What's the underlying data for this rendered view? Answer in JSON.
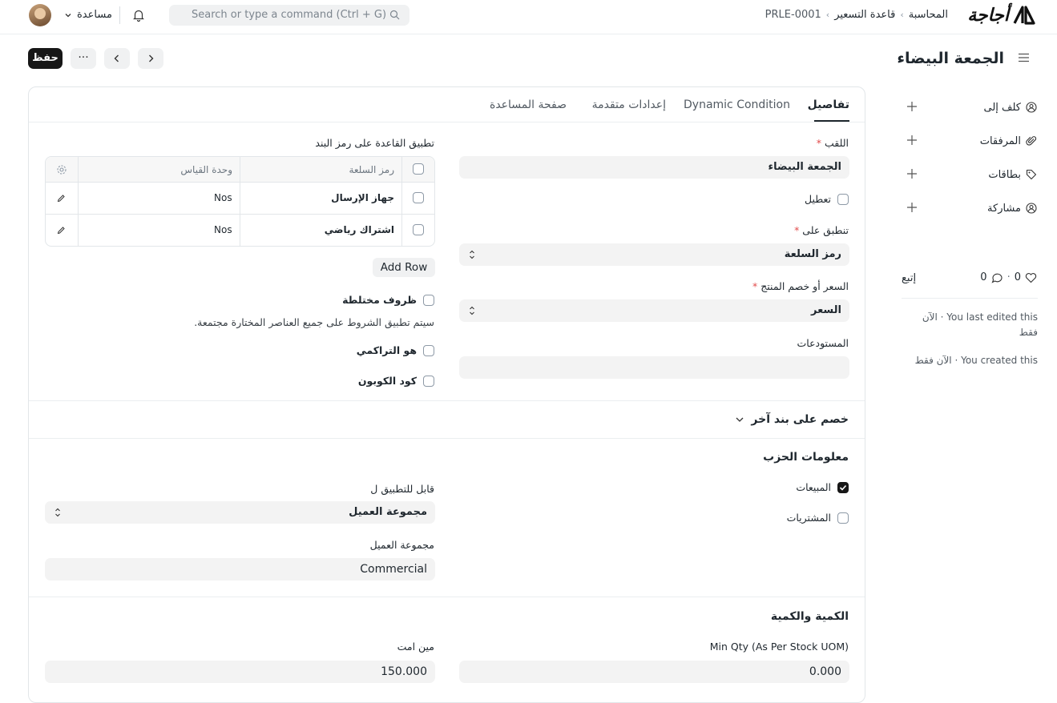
{
  "navbar": {
    "help_label": "مساعدة",
    "search_placeholder": "Search or type a command (Ctrl + G)",
    "breadcrumbs": [
      "المحاسبة",
      "قاعدة التسعير",
      "PRLE-0001"
    ],
    "logo_text": "أجاجة"
  },
  "toolbar": {
    "save_label": "حفظ",
    "more_label": "···",
    "page_title": "الجمعة البيضاء"
  },
  "sidebar": {
    "items": [
      {
        "label": "كلف إلى",
        "icon": "user-plus-icon"
      },
      {
        "label": "المرفقات",
        "icon": "paperclip-icon"
      },
      {
        "label": "بطاقات",
        "icon": "tag-icon"
      },
      {
        "label": "مشاركة",
        "icon": "share-user-icon"
      }
    ],
    "likes": "0",
    "comments": "0",
    "follow_label": "إتبع",
    "activity": [
      "You last edited this · الآن",
      "فقط",
      "You created this · الآن فقط"
    ]
  },
  "tabs": [
    {
      "label": "تفاصيل",
      "active": true
    },
    {
      "label": "Dynamic Condition",
      "active": false
    },
    {
      "label": "إعدادات متقدمة",
      "active": false
    },
    {
      "label": "صفحة المساعدة",
      "active": false
    }
  ],
  "form": {
    "title_label": "اللقب",
    "title_value": "الجمعة البيضاء",
    "disable_label": "تعطيل",
    "apply_on_label": "تنطبق على",
    "apply_on_value": "رمز السلعة",
    "price_or_discount_label": "السعر أو خصم المنتج",
    "price_or_discount_value": "السعر",
    "warehouses_label": "المستودعات",
    "warehouses_value": "",
    "apply_rule_on_label": "تطبيق القاعدة على رمز البند",
    "grid": {
      "columns": [
        "رمز السلعة",
        "وحدة القياس"
      ],
      "rows": [
        {
          "item_code": "جهاز الإرسال",
          "uom": "Nos"
        },
        {
          "item_code": "اشتراك رياضي",
          "uom": "Nos"
        }
      ],
      "add_row_label": "Add Row"
    },
    "mixed_conditions_label": "ظروف مختلطة",
    "mixed_conditions_help": "سيتم تطبيق الشروط على جميع العناصر المختارة مجتمعة.",
    "is_cumulative_label": "هو التراكمي",
    "coupon_code_label": "كود الكوبون"
  },
  "discount_section": {
    "title": "خصم على بند آخر"
  },
  "party_section": {
    "title": "معلومات الحزب",
    "selling_label": "المبيعات",
    "selling_checked": true,
    "buying_label": "المشتريات",
    "buying_checked": false,
    "applicable_for_label": "قابل للتطبيق ل",
    "applicable_for_value": "مجموعة العميل",
    "customer_group_label": "مجموعة العميل",
    "customer_group_value": "Commercial"
  },
  "qty_section": {
    "title": "الكمية والكمية",
    "min_qty_uom_label": "Min Qty (As Per Stock UOM)",
    "min_qty_uom_value": "0.000",
    "min_amt_label": "مين امت",
    "min_amt_value": "150.000"
  }
}
